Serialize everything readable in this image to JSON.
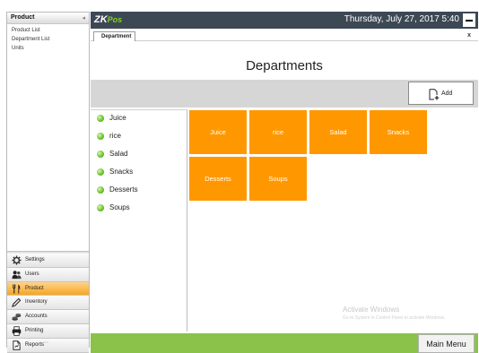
{
  "sidebar": {
    "header": "Product",
    "links": [
      "Product List",
      "Department List",
      "Units"
    ],
    "nav": [
      {
        "label": "Settings",
        "icon": "gear-icon"
      },
      {
        "label": "Users",
        "icon": "users-icon"
      },
      {
        "label": "Product",
        "icon": "fork-knife-icon",
        "active": true
      },
      {
        "label": "Inventory",
        "icon": "pencil-icon"
      },
      {
        "label": "Accounts",
        "icon": "coins-icon"
      },
      {
        "label": "Printing",
        "icon": "printer-icon"
      },
      {
        "label": "Reports",
        "icon": "report-icon"
      }
    ]
  },
  "app": {
    "logo_main": "ZK",
    "logo_sub": "Pos",
    "datetime": "Thursday, July 27, 2017 5:40"
  },
  "tab": {
    "label": "Department",
    "close": "x"
  },
  "page": {
    "title": "Departments"
  },
  "toolbar": {
    "add_label": "Add"
  },
  "departments": {
    "list": [
      "Juice",
      "rice",
      "Salad",
      "Snacks",
      "Desserts",
      "Soups"
    ],
    "tiles": [
      "Juice",
      "rice",
      "Salad",
      "Snacks",
      "Desserts",
      "Soups"
    ]
  },
  "watermark": {
    "line1": "Activate Windows",
    "line2": "Go to System in Control Panel to activate Windows."
  },
  "footer": {
    "main_menu_label": "Main Menu"
  },
  "colors": {
    "tile": "#ff9800",
    "titlebar": "#3d4855",
    "footer": "#8bc34a",
    "active_nav": "#f5a623"
  }
}
